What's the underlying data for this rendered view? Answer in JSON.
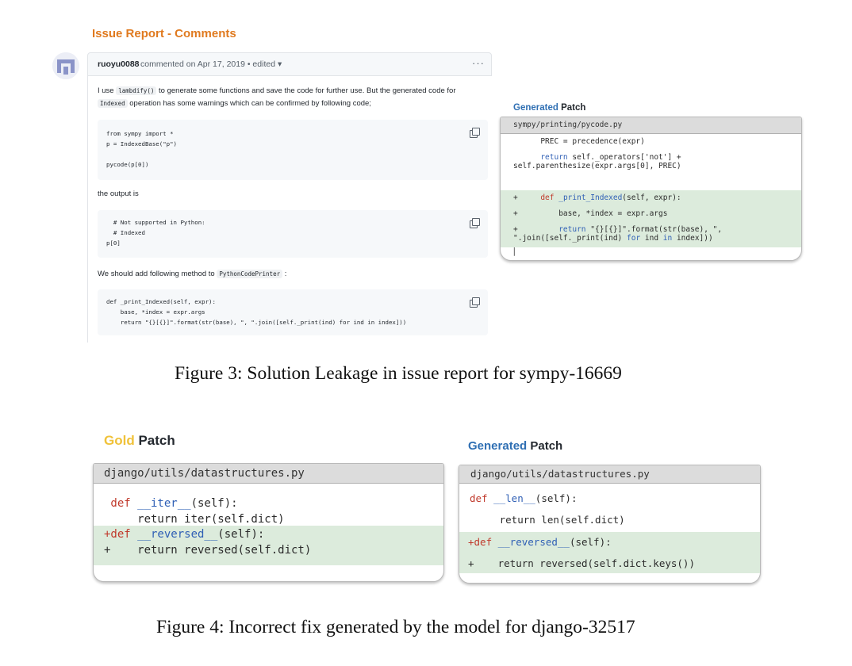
{
  "figure3": {
    "section_title": "Issue Report - Comments",
    "comment": {
      "username": "ruoyu0088",
      "meta": "commented on Apr 17, 2019 • edited ▾",
      "more": "···",
      "p1_a": "I use",
      "p1_code": "lambdify()",
      "p1_b": "to generate some functions and save the code for further use. But the generated code for",
      "p2_code": "Indexed",
      "p2_b": "operation has some warnings which can be confirmed by following code;",
      "code1": "from sympy import *\np = IndexedBase(\"p\")\n\npycode(p[0])",
      "p3": "the output is",
      "code2": "  # Not supported in Python:\n  # Indexed\np[0]",
      "p4_a": "We should add following method to",
      "p4_code": "PythonCodePrinter",
      "p4_b": ":",
      "code3": "def _print_Indexed(self, expr):\n    base, *index = expr.args\n    return \"{}[{}]\".format(str(base), \", \".join([self._print(ind) for ind in index]))"
    },
    "generated_patch": {
      "title_a": "Generated",
      "title_b": "Patch",
      "file": "sympy/printing/pycode.py",
      "l1": "      PREC = precedence(expr)",
      "l2a": "      ",
      "l2b": "return",
      "l2c": " self._operators['not'] +",
      "l3": "self.parenthesize(expr.args[0], PREC)",
      "l4a": "+     ",
      "l4b": "def",
      "l4c": " _print_Indexed",
      "l4d": "(self, expr):",
      "l5": "+         base, *index = expr.args",
      "l6a": "+         ",
      "l6b": "return",
      "l6c": " \"{}[{}]\".format(str(base), \",",
      "l7a": "\".join([self._print(ind) ",
      "l7b": "for",
      "l7c": " ind ",
      "l7d": "in",
      "l7e": " index]))",
      "cursor": "|"
    },
    "caption": "Figure 3: Solution Leakage in issue report for sympy-16669"
  },
  "figure4": {
    "gold": {
      "title_a": "Gold",
      "title_b": " Patch",
      "file": "django/utils/datastructures.py",
      "l1a": " def",
      "l1b": " __iter__",
      "l1c": "(self):",
      "l2": "     return iter(self.dict)",
      "l3a": "+def",
      "l3b": " __reversed__",
      "l3c": "(self):",
      "l4": "+    return reversed(self.dict)"
    },
    "generated": {
      "title_a": "Generated",
      "title_b": " Patch",
      "file": "django/utils/datastructures.py",
      "l1a": "def",
      "l1b": " __len__",
      "l1c": "(self):",
      "l2": "     return len(self.dict)",
      "l3a": "+def",
      "l3b": " __reversed__",
      "l3c": "(self):",
      "l4": "+    return reversed(self.dict.keys())"
    },
    "caption": "Figure 4: Incorrect fix generated by the model for django-32517"
  }
}
